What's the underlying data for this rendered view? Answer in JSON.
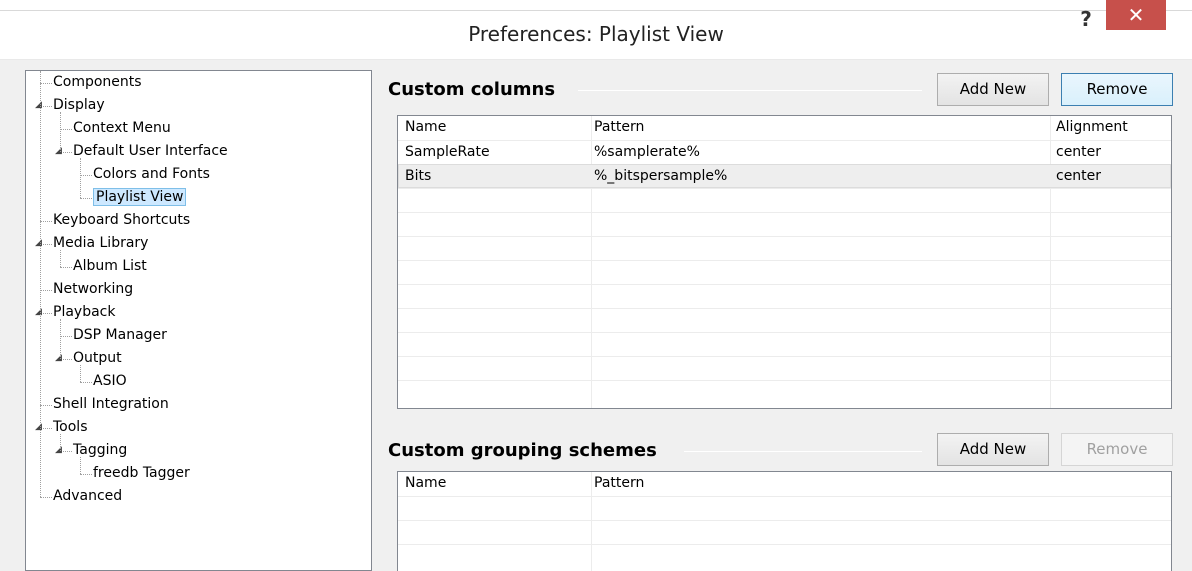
{
  "window": {
    "title": "Preferences: Playlist View",
    "help_label": "?",
    "close_label": "✕"
  },
  "tree": {
    "items": [
      {
        "label": "Components",
        "level": 0,
        "expander": ""
      },
      {
        "label": "Display",
        "level": 0,
        "expander": "◢"
      },
      {
        "label": "Context Menu",
        "level": 1,
        "expander": ""
      },
      {
        "label": "Default User Interface",
        "level": 1,
        "expander": "◢"
      },
      {
        "label": "Colors and Fonts",
        "level": 2,
        "expander": ""
      },
      {
        "label": "Playlist View",
        "level": 2,
        "expander": "",
        "selected": true
      },
      {
        "label": "Keyboard Shortcuts",
        "level": 0,
        "expander": ""
      },
      {
        "label": "Media Library",
        "level": 0,
        "expander": "◢"
      },
      {
        "label": "Album List",
        "level": 1,
        "expander": ""
      },
      {
        "label": "Networking",
        "level": 0,
        "expander": ""
      },
      {
        "label": "Playback",
        "level": 0,
        "expander": "◢"
      },
      {
        "label": "DSP Manager",
        "level": 1,
        "expander": ""
      },
      {
        "label": "Output",
        "level": 1,
        "expander": "◢"
      },
      {
        "label": "ASIO",
        "level": 2,
        "expander": ""
      },
      {
        "label": "Shell Integration",
        "level": 0,
        "expander": ""
      },
      {
        "label": "Tools",
        "level": 0,
        "expander": "◢"
      },
      {
        "label": "Tagging",
        "level": 1,
        "expander": "◢"
      },
      {
        "label": "freedb Tagger",
        "level": 2,
        "expander": ""
      },
      {
        "label": "Advanced",
        "level": 0,
        "expander": ""
      }
    ]
  },
  "custom_columns": {
    "title": "Custom columns",
    "add_label": "Add New",
    "remove_label": "Remove",
    "headers": [
      "Name",
      "Pattern",
      "Alignment"
    ],
    "rows": [
      [
        "SampleRate",
        "%samplerate%",
        "center"
      ],
      [
        "Bits",
        "%_bitspersample%",
        "center"
      ]
    ]
  },
  "grouping": {
    "title": "Custom grouping schemes",
    "add_label": "Add New",
    "remove_label": "Remove",
    "headers": [
      "Name",
      "Pattern"
    ]
  }
}
